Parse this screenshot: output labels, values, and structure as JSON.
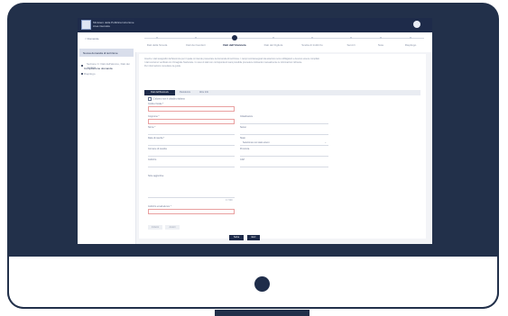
{
  "header": {
    "org_name": "Ministero della Pubblica Istruzione",
    "org_sub": "Area riservata"
  },
  "sidebar": {
    "back_label": "< Domande",
    "current_label": "Nuova domanda di iscrizione",
    "sub_item": "Compilazione domanda",
    "sub_detail": "Sezione C: Dati dell'alunno, Dati dei genitori",
    "sub_item_2": "Riepilogo"
  },
  "steps": [
    "Dati della Scuola",
    "Dati dei Genitori",
    "Dati dell'Alunno/a",
    "Dati del Figlio/a",
    "Scelta di Indirizzo",
    "Servizi",
    "Note",
    "Riepilogo"
  ],
  "banner": {
    "line1": "Inserire i dati anagrafici dell'alunno/a per il quale si intende presentare la domanda di iscrizione. I campi contrassegnati da asterisco sono obbligatori e devono essere compilati.",
    "line2": "I dati verranno verificati con l'Anagrafe Nazionale. In caso di dati non corrispondenti sarà possibile procedere indicando manualmente le informazioni richieste.",
    "line3": "Per informazioni consultare la guida."
  },
  "tabs": [
    "Dati dell'Alunno/a",
    "Residenza",
    "Altre Info"
  ],
  "form": {
    "checkbox_label": "L'alunno non è cittadino italiano",
    "codice_fiscale": "Codice fiscale *",
    "cognome": "Cognome *",
    "nome": "Nome *",
    "cittadinanza": "Cittadinanza",
    "data_nascita": "Data di nascita *",
    "sesso": "Sesso",
    "comune_nascita": "Comune di nascita",
    "stato": "Stato",
    "stato_value": "Seleziona uno stato estero",
    "provincia": "Provincia",
    "cap": "CAP",
    "indirizzo": "Indirizzo",
    "note_label": "Note aggiuntive",
    "note_counter": "0 / 500",
    "email_label": "Indirizzo email alunno *"
  },
  "buttons": {
    "prev": "Indietro",
    "next": "Avanti",
    "save": "Salva",
    "exit": "Esci"
  }
}
